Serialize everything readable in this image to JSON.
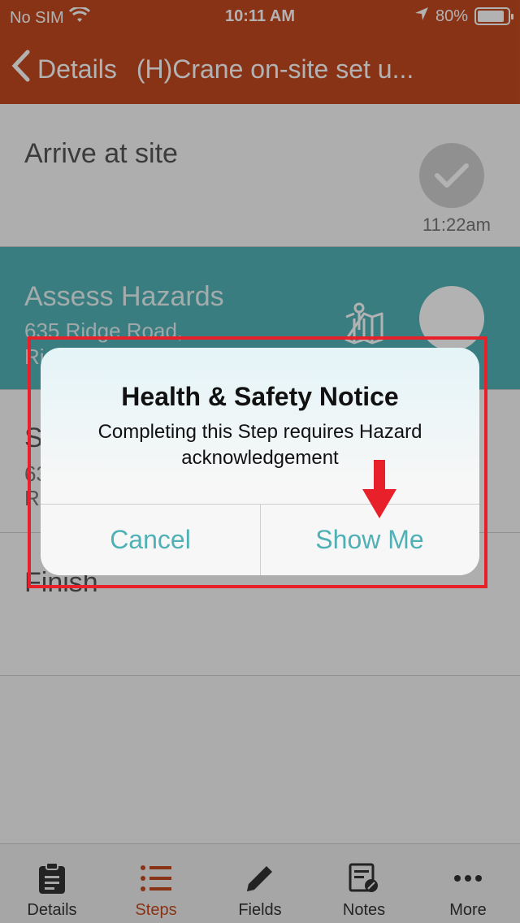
{
  "status": {
    "carrier": "No SIM",
    "time": "10:11 AM",
    "battery": "80%"
  },
  "nav": {
    "back_label": "Details",
    "title": "(H)Crane on-site set u..."
  },
  "steps": [
    {
      "title": "Arrive at site",
      "timestamp": "11:22am"
    },
    {
      "title": "Assess Hazards",
      "line1": "635 Ridge Road,",
      "line2": "Ri..."
    },
    {
      "title": "S...",
      "line1": "63...",
      "line2": "R..."
    },
    {
      "title": "Finish"
    }
  ],
  "alert": {
    "title": "Health & Safety Notice",
    "message": "Completing this Step requires Hazard acknowledgement",
    "cancel": "Cancel",
    "confirm": "Show Me"
  },
  "tabs": [
    {
      "label": "Details",
      "icon": "clipboard-icon"
    },
    {
      "label": "Steps",
      "icon": "list-icon",
      "active": true
    },
    {
      "label": "Fields",
      "icon": "pencil-icon"
    },
    {
      "label": "Notes",
      "icon": "notes-icon"
    },
    {
      "label": "More",
      "icon": "more-icon"
    }
  ],
  "colors": {
    "accent": "#c54a20",
    "teal": "#52b4b8",
    "highlight": "#e8202a"
  }
}
